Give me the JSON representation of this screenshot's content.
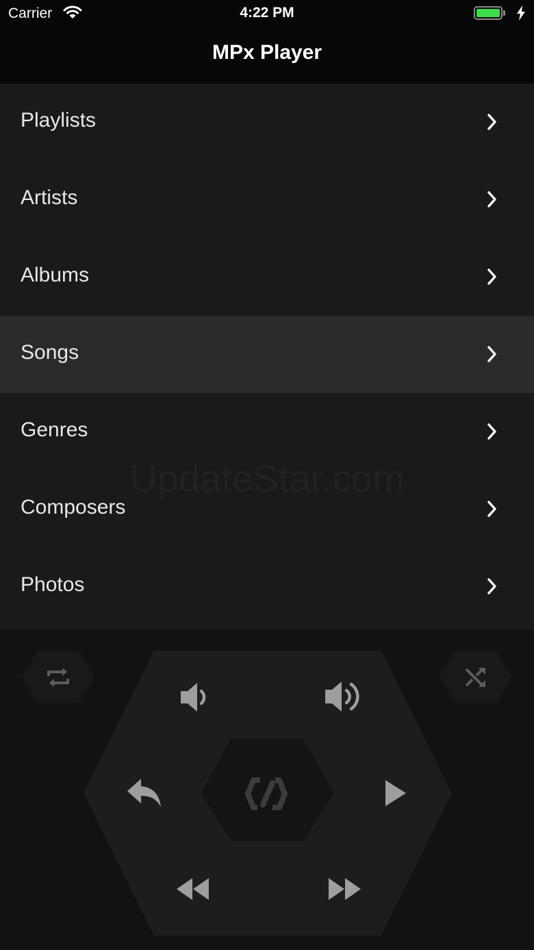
{
  "status_bar": {
    "carrier": "Carrier",
    "time": "4:22 PM",
    "battery_color": "#3ddc4a"
  },
  "nav": {
    "title": "MPx Player"
  },
  "menu": {
    "items": [
      {
        "label": "Playlists",
        "icon": "chevron-right-icon"
      },
      {
        "label": "Artists",
        "icon": "chevron-right-icon"
      },
      {
        "label": "Albums",
        "icon": "chevron-right-icon"
      },
      {
        "label": "Songs",
        "icon": "chevron-right-icon",
        "selected": true
      },
      {
        "label": "Genres",
        "icon": "chevron-right-icon"
      },
      {
        "label": "Composers",
        "icon": "chevron-right-icon"
      },
      {
        "label": "Photos",
        "icon": "chevron-right-icon"
      }
    ]
  },
  "watermark": "UpdateStar.com",
  "controls": {
    "icons": [
      "repeat-icon",
      "shuffle-icon",
      "volume-down-icon",
      "volume-up-icon",
      "back-icon",
      "logo-icon",
      "play-icon",
      "rewind-icon",
      "fast-forward-icon"
    ]
  }
}
